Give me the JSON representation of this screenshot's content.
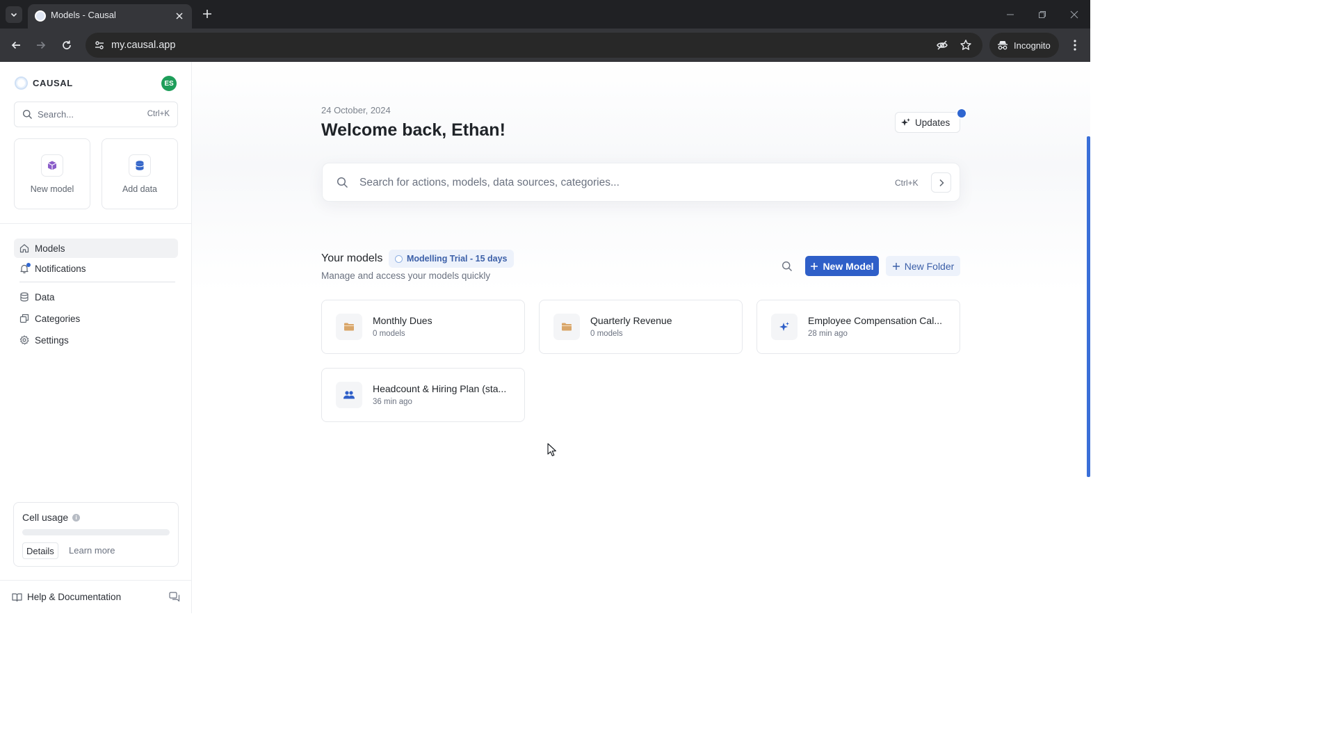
{
  "browser": {
    "tab_title": "Models - Causal",
    "url": "my.causal.app",
    "incognito_label": "Incognito"
  },
  "sidebar": {
    "brand": "CAUSAL",
    "avatar_initials": "ES",
    "search": {
      "placeholder": "Search...",
      "shortcut": "Ctrl+K"
    },
    "quick_actions": [
      {
        "label": "New model",
        "icon": "cube-icon"
      },
      {
        "label": "Add data",
        "icon": "database-icon"
      }
    ],
    "nav": [
      {
        "label": "Models",
        "icon": "home-icon",
        "active": true
      },
      {
        "label": "Notifications",
        "icon": "bell-icon",
        "active": false
      },
      {
        "label": "Data",
        "icon": "database-icon",
        "active": false
      },
      {
        "label": "Categories",
        "icon": "categories-icon",
        "active": false
      },
      {
        "label": "Settings",
        "icon": "gear-icon",
        "active": false
      }
    ],
    "cell_usage": {
      "title": "Cell usage",
      "details_label": "Details",
      "learn_more_label": "Learn more",
      "progress": 0
    },
    "help_label": "Help & Documentation"
  },
  "main": {
    "date": "24 October, 2024",
    "welcome": "Welcome back, Ethan!",
    "updates_label": "Updates",
    "search": {
      "placeholder": "Search for actions, models, data sources, categories...",
      "shortcut": "Ctrl+K"
    },
    "models": {
      "title": "Your models",
      "trial_badge": "Modelling Trial - 15 days",
      "subtitle": "Manage and access your models quickly",
      "new_model_label": "New Model",
      "new_folder_label": "New Folder",
      "items": [
        {
          "title": "Monthly Dues",
          "subtitle": "0 models",
          "icon": "folder-icon"
        },
        {
          "title": "Quarterly Revenue",
          "subtitle": "0 models",
          "icon": "folder-icon"
        },
        {
          "title": "Employee Compensation Cal...",
          "subtitle": "28 min ago",
          "icon": "sparkle-icon"
        },
        {
          "title": "Headcount & Hiring Plan (sta...",
          "subtitle": "36 min ago",
          "icon": "users-icon"
        }
      ]
    }
  },
  "colors": {
    "primary": "#2f5fc8",
    "primary_soft": "#edf2fb",
    "avatar": "#1e9e5a",
    "folder_icon": "#d9a66a"
  }
}
